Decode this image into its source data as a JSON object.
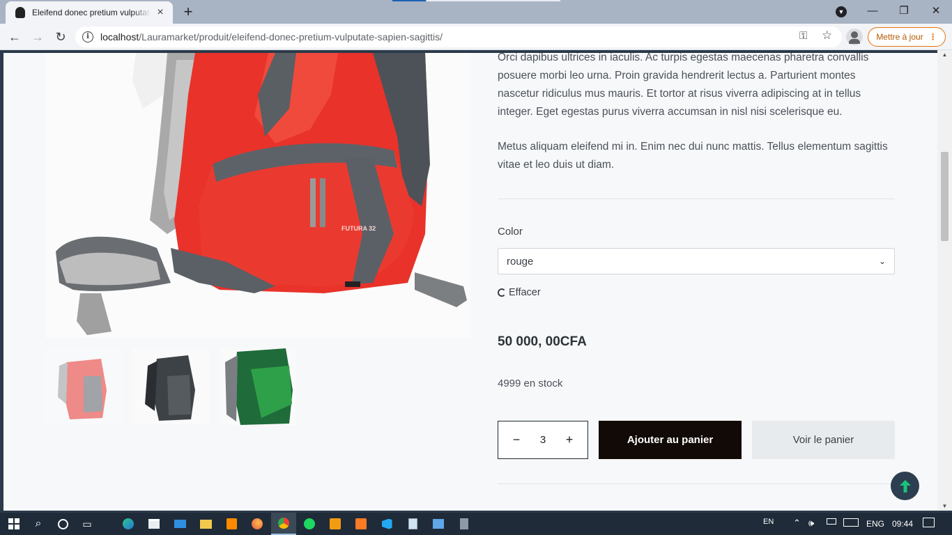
{
  "browser": {
    "tab_title": "Eleifend donec pretium vulputate",
    "url_host": "localhost",
    "url_path": "/Lauramarket/produit/eleifend-donec-pretium-vulputate-sapien-sagittis/",
    "update_label": "Mettre à jour"
  },
  "product": {
    "description_p1": "Orci dapibus ultrices in iaculis. Ac turpis egestas maecenas pharetra convallis posuere morbi leo urna. Proin gravida hendrerit lectus a. Parturient montes nascetur ridiculus mus mauris. Et tortor at risus viverra adipiscing at in tellus integer. Eget egestas purus viverra accumsan in nisl nisi scelerisque eu.",
    "description_p2": "Metus aliquam eleifend mi in. Enim nec dui nunc mattis. Tellus elementum sagittis vitae et leo duis ut diam.",
    "color_label": "Color",
    "color_value": "rouge",
    "clear_label": "Effacer",
    "price": "50 000, 00CFA",
    "stock": "4999 en stock",
    "quantity": "3",
    "add_to_cart_label": "Ajouter au panier",
    "view_cart_label": "Voir le panier",
    "image_text": "FUTURA 32",
    "thumbnails": [
      "red",
      "grey",
      "green"
    ]
  },
  "taskbar": {
    "lang_short": "EN",
    "lang": "ENG",
    "time": "09:44"
  },
  "colors": {
    "accent_orange": "#e8710a",
    "cart_button": "#120a06",
    "back_to_top": "#2c3e4f"
  }
}
